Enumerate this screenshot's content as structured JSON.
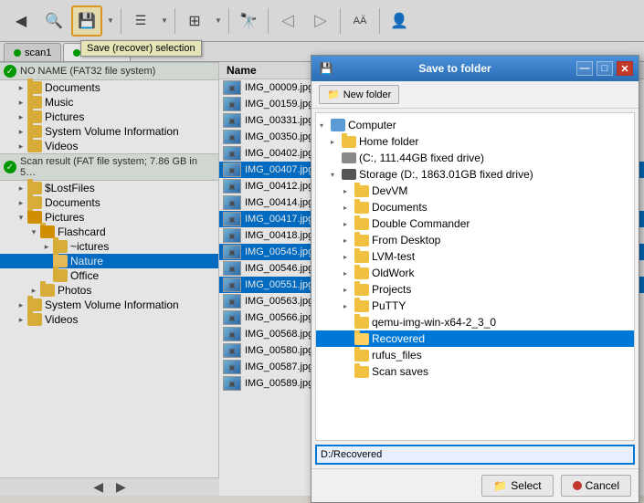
{
  "toolbar": {
    "buttons": [
      {
        "id": "back",
        "icon": "◀",
        "label": "Back"
      },
      {
        "id": "search",
        "icon": "🔍",
        "label": "Search"
      },
      {
        "id": "save",
        "icon": "💾",
        "label": "Save (recover) selection",
        "active": true
      },
      {
        "id": "save-arrow",
        "icon": "▼"
      },
      {
        "id": "list",
        "icon": "≡",
        "label": "List"
      },
      {
        "id": "list-arrow",
        "icon": "▼"
      },
      {
        "id": "grid",
        "icon": "⊞",
        "label": "Grid"
      },
      {
        "id": "grid-arrow",
        "icon": "▼"
      },
      {
        "id": "find",
        "icon": "🔭",
        "label": "Find"
      },
      {
        "id": "prev",
        "icon": "◁",
        "label": "Previous"
      },
      {
        "id": "next",
        "icon": "▷",
        "label": "Next"
      },
      {
        "id": "text",
        "icon": "AÄ",
        "label": "Text"
      },
      {
        "id": "person",
        "icon": "👤",
        "label": "Person"
      }
    ],
    "tooltip": "Save (recover) selection"
  },
  "tabs": [
    {
      "id": "scan1",
      "label": "scan1",
      "dot_color": "#00aa00",
      "active": false
    },
    {
      "id": "pictures",
      "label": "Pictures",
      "dot_color": "#00aa00",
      "active": true
    }
  ],
  "left_panel": {
    "sections": [
      {
        "id": "fat32",
        "type": "section-header",
        "label": "NO NAME (FAT32 file system)",
        "icon": "green-circle"
      },
      {
        "id": "documents1",
        "label": "Documents",
        "indent": 1,
        "expanded": false
      },
      {
        "id": "music",
        "label": "Music",
        "indent": 1,
        "expanded": false
      },
      {
        "id": "pictures1",
        "label": "Pictures",
        "indent": 1,
        "expanded": false
      },
      {
        "id": "sysvolinfo1",
        "label": "System Volume Information",
        "indent": 1,
        "expanded": false
      },
      {
        "id": "videos1",
        "label": "Videos",
        "indent": 1,
        "expanded": false
      },
      {
        "id": "scan-result",
        "type": "section-header",
        "label": "Scan result (FAT file system; 7.86 GB in 5…",
        "icon": "green-circle"
      },
      {
        "id": "lostfiles",
        "label": "$LostFiles",
        "indent": 1,
        "expanded": false
      },
      {
        "id": "documents2",
        "label": "Documents",
        "indent": 1,
        "expanded": false
      },
      {
        "id": "pictures2",
        "label": "Pictures",
        "indent": 1,
        "expanded": true
      },
      {
        "id": "flashcard",
        "label": "Flashcard",
        "indent": 2,
        "expanded": true
      },
      {
        "id": "ictures",
        "label": "~ictures",
        "indent": 3,
        "expanded": false
      },
      {
        "id": "nature",
        "label": "Nature",
        "indent": 3,
        "expanded": false,
        "selected": true
      },
      {
        "id": "office",
        "label": "Office",
        "indent": 3,
        "expanded": false
      },
      {
        "id": "photos",
        "label": "Photos",
        "indent": 2,
        "expanded": false
      },
      {
        "id": "sysvolinfo2",
        "label": "System Volume Information",
        "indent": 1,
        "expanded": false
      },
      {
        "id": "videos2",
        "label": "Videos",
        "indent": 1,
        "expanded": false
      }
    ]
  },
  "file_list": {
    "header": "Name",
    "files": [
      {
        "name": "IMG_00009.jpg",
        "selected": false
      },
      {
        "name": "IMG_00159.jpg",
        "selected": false
      },
      {
        "name": "IMG_00331.jpg",
        "selected": false
      },
      {
        "name": "IMG_00350.jpg",
        "selected": false
      },
      {
        "name": "IMG_00402.jpg",
        "selected": false
      },
      {
        "name": "IMG_00407.jpg",
        "selected": true
      },
      {
        "name": "IMG_00412.jpg",
        "selected": false
      },
      {
        "name": "IMG_00414.jpg",
        "selected": false
      },
      {
        "name": "IMG_00417.jpg",
        "selected": true
      },
      {
        "name": "IMG_00418.jpg",
        "selected": false
      },
      {
        "name": "IMG_00545.jpg",
        "selected": true
      },
      {
        "name": "IMG_00546.jpg",
        "selected": false
      },
      {
        "name": "IMG_00551.jpg",
        "selected": true
      },
      {
        "name": "IMG_00563.jpg",
        "selected": false
      },
      {
        "name": "IMG_00566.jpg",
        "selected": false
      },
      {
        "name": "IMG_00568.jpg",
        "selected": false
      },
      {
        "name": "IMG_00580.jpg",
        "selected": false
      },
      {
        "name": "IMG_00587.jpg",
        "selected": false
      },
      {
        "name": "IMG_00589.jpg",
        "selected": false
      }
    ]
  },
  "modal": {
    "title": "Save to folder",
    "title_icon": "💾",
    "new_folder_label": "New folder",
    "tree": [
      {
        "id": "computer",
        "label": "Computer",
        "indent": 0,
        "expanded": true,
        "type": "computer"
      },
      {
        "id": "home",
        "label": "Home folder",
        "indent": 1,
        "expanded": false,
        "type": "folder"
      },
      {
        "id": "cdrive",
        "label": "(C:, 111.44GB fixed drive)",
        "indent": 1,
        "expanded": false,
        "type": "drive"
      },
      {
        "id": "ddrive",
        "label": "Storage (D:, 1863.01GB fixed drive)",
        "indent": 1,
        "expanded": true,
        "type": "drive-storage"
      },
      {
        "id": "devvm",
        "label": "DevVM",
        "indent": 2,
        "expanded": false,
        "type": "folder"
      },
      {
        "id": "documents",
        "label": "Documents",
        "indent": 2,
        "expanded": false,
        "type": "folder"
      },
      {
        "id": "double-commander",
        "label": "Double Commander",
        "indent": 2,
        "expanded": false,
        "type": "folder"
      },
      {
        "id": "from-desktop",
        "label": "From Desktop",
        "indent": 2,
        "expanded": false,
        "type": "folder"
      },
      {
        "id": "lvm-test",
        "label": "LVM-test",
        "indent": 2,
        "expanded": false,
        "type": "folder"
      },
      {
        "id": "oldwork",
        "label": "OldWork",
        "indent": 2,
        "expanded": false,
        "type": "folder"
      },
      {
        "id": "projects",
        "label": "Projects",
        "indent": 2,
        "expanded": false,
        "type": "folder"
      },
      {
        "id": "putty",
        "label": "PuTTY",
        "indent": 2,
        "expanded": false,
        "type": "folder"
      },
      {
        "id": "qemu",
        "label": "qemu-img-win-x64-2_3_0",
        "indent": 2,
        "expanded": false,
        "type": "folder"
      },
      {
        "id": "recovered",
        "label": "Recovered",
        "indent": 2,
        "expanded": false,
        "type": "folder",
        "selected": true
      },
      {
        "id": "rufus",
        "label": "rufus_files",
        "indent": 2,
        "expanded": false,
        "type": "folder"
      },
      {
        "id": "scansaves",
        "label": "Scan saves",
        "indent": 2,
        "expanded": false,
        "type": "folder"
      }
    ],
    "path_value": "D:/Recovered",
    "select_label": "Select",
    "cancel_label": "Cancel",
    "win_buttons": [
      {
        "id": "minimize",
        "label": "—"
      },
      {
        "id": "maximize",
        "label": "□"
      },
      {
        "id": "close",
        "label": "✕"
      }
    ]
  }
}
